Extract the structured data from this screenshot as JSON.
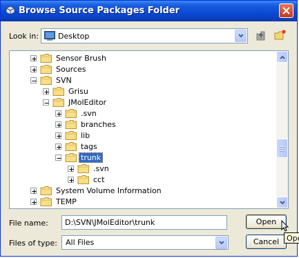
{
  "window": {
    "title": "Browse Source Packages Folder"
  },
  "look_in": {
    "label": "Look in:",
    "value": "Desktop"
  },
  "tree": {
    "rows": [
      {
        "label": "Sensor Brush",
        "expander": "plus",
        "level": 2
      },
      {
        "label": "Sources",
        "expander": "plus",
        "level": 2
      },
      {
        "label": "SVN",
        "expander": "minus",
        "level": 2
      },
      {
        "label": "Grisu",
        "expander": "plus",
        "level": 3
      },
      {
        "label": "JMolEditor",
        "expander": "minus",
        "level": 3
      },
      {
        "label": ".svn",
        "expander": "plus",
        "level": 4
      },
      {
        "label": "branches",
        "expander": "plus",
        "level": 4
      },
      {
        "label": "lib",
        "expander": "plus",
        "level": 4
      },
      {
        "label": "tags",
        "expander": "plus",
        "level": 4
      },
      {
        "label": "trunk",
        "expander": "minus",
        "level": 4,
        "selected": true
      },
      {
        "label": ".svn",
        "expander": "plus",
        "level": 5
      },
      {
        "label": "cct",
        "expander": "plus",
        "level": 5
      },
      {
        "label": "System Volume Information",
        "expander": "plus",
        "level": 2
      },
      {
        "label": "TEMP",
        "expander": "plus",
        "level": 2
      }
    ]
  },
  "file_name": {
    "label": "File name:",
    "value": "D:\\SVN\\JMolEditor\\trunk"
  },
  "file_type": {
    "label": "Files of type:",
    "value": "All Files"
  },
  "buttons": {
    "open": "Open",
    "cancel": "Cancel"
  },
  "tooltip": "Ope",
  "colors": {
    "titlebar": "#0a4bd6",
    "selection": "#316ac5",
    "dialog_bg": "#ece9d8"
  }
}
